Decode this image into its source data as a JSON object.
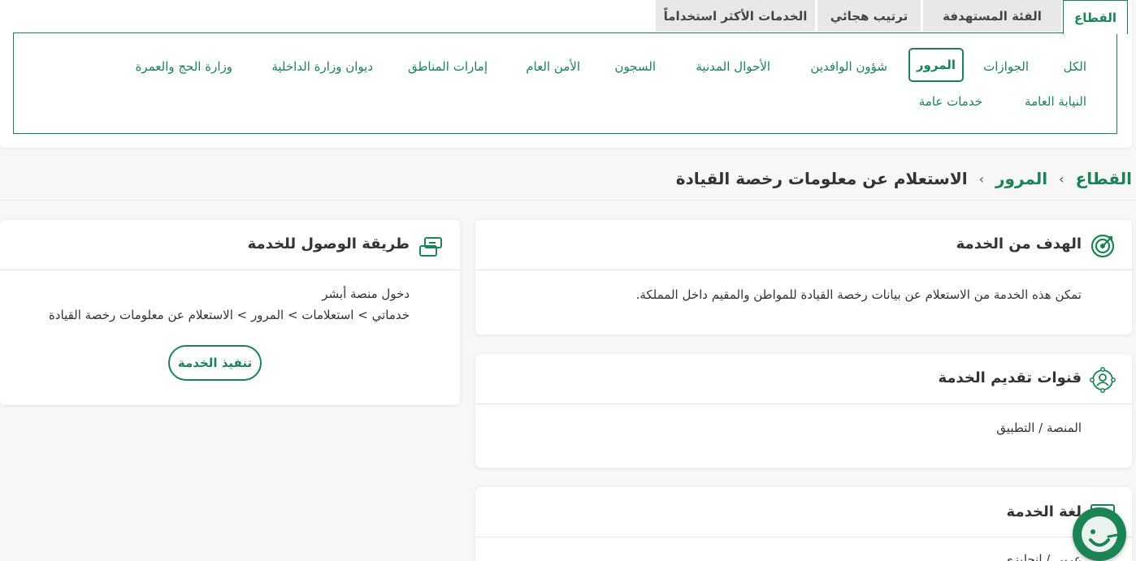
{
  "tabs": [
    {
      "label": "القطاع"
    },
    {
      "label": "الفئة المستهدفة"
    },
    {
      "label": "ترتيب هجائي"
    },
    {
      "label": "الخدمات الأكثر استخداماً"
    }
  ],
  "sectors": [
    {
      "label": "الكل"
    },
    {
      "label": "الجوازات"
    },
    {
      "label": "المرور"
    },
    {
      "label": "شؤون الوافدين"
    },
    {
      "label": "الأحوال المدنية"
    },
    {
      "label": "السجون"
    },
    {
      "label": "الأمن العام"
    },
    {
      "label": "إمارات المناطق"
    },
    {
      "label": "ديوان وزارة الداخلية"
    },
    {
      "label": "وزارة الحج والعمرة"
    },
    {
      "label": "النيابة العامة"
    },
    {
      "label": "خدمات عامة"
    }
  ],
  "breadcrumb": {
    "root": "القطاع",
    "sector": "المرور",
    "current": "الاستعلام عن معلومات رخصة القيادة",
    "separator": "›"
  },
  "cards": {
    "goal": {
      "title": "الهدف من الخدمة",
      "body": "تمكن هذه الخدمة من الاستعلام عن بيانات رخصة القيادة للمواطن والمقيم داخل المملكة."
    },
    "channels": {
      "title": "قنوات تقديم الخدمة",
      "body": "المنصة / التطبيق"
    },
    "language": {
      "title": "لغة الخدمة",
      "body": "عربي / إنجليزي"
    },
    "access": {
      "title": "طريقة الوصول للخدمة",
      "line1": "دخول منصة أبشر",
      "line2": "خدماتي > استعلامات > المرور > الاستعلام عن معلومات رخصة القيادة",
      "button": "تنفيذ الخدمة"
    }
  },
  "colors": {
    "accent": "#1b8354",
    "tab_bg": "#e8e8e8",
    "page_bg": "#f7f7f7"
  },
  "icons": [
    "target-icon",
    "channels-icon",
    "language-icon",
    "access-link-icon",
    "chatbot-icon"
  ]
}
